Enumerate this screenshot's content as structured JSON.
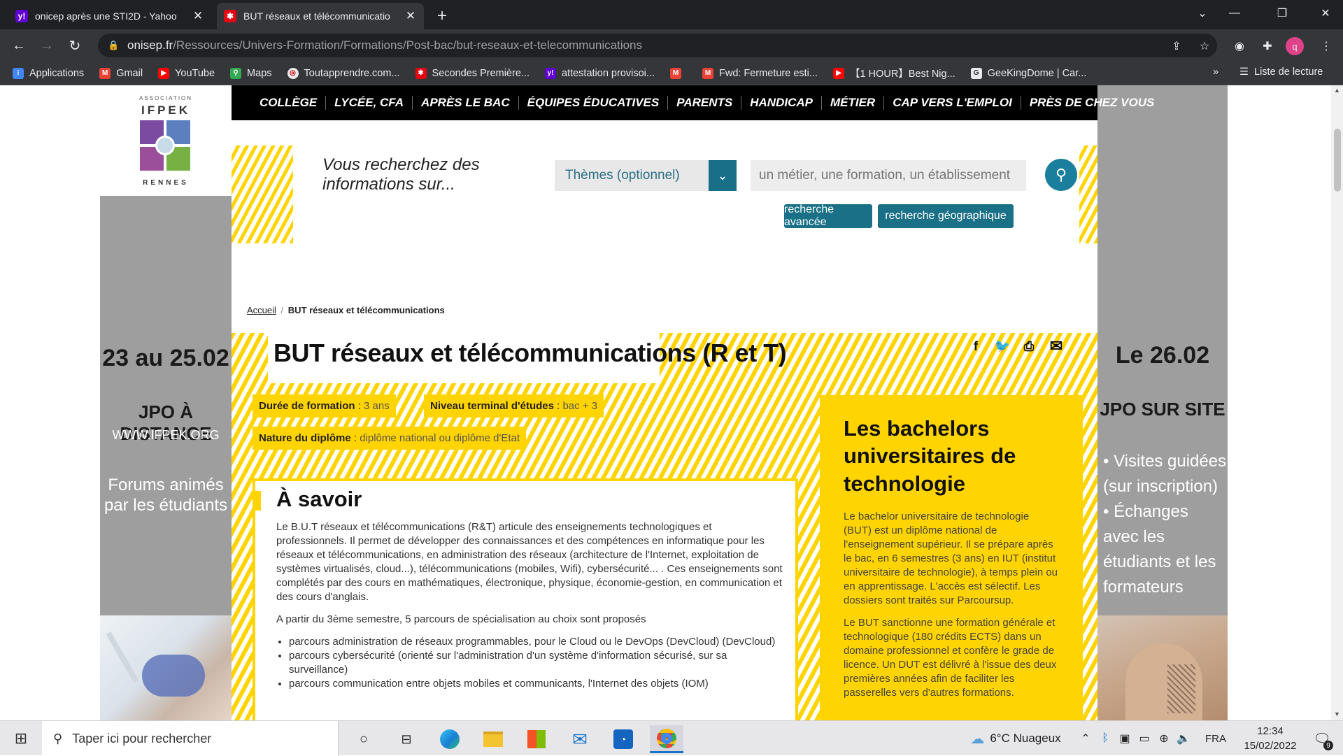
{
  "browser": {
    "tabs": [
      {
        "title": "onicep après une STI2D - Yahoo",
        "favicon": "yahoo-icon",
        "active": false
      },
      {
        "title": "BUT réseaux et télécommunicatio",
        "favicon": "onisep-icon",
        "active": true
      }
    ],
    "new_tab": "+",
    "url_host": "onisep.fr",
    "url_path": "/Ressources/Univers-Formation/Formations/Post-bac/but-reseaux-et-telecommunications",
    "bookmarks": [
      {
        "label": "Applications",
        "icon": "apps-grid-icon",
        "color": "#4285f4"
      },
      {
        "label": "Gmail",
        "icon": "gmail-icon",
        "color": "#ea4335"
      },
      {
        "label": "YouTube",
        "icon": "youtube-icon",
        "color": "#ff0000"
      },
      {
        "label": "Maps",
        "icon": "maps-icon",
        "color": "#34a853"
      },
      {
        "label": "Toutapprendre.com...",
        "icon": "toutapprendre-icon",
        "color": "#e8eaed"
      },
      {
        "label": "Secondes Première...",
        "icon": "onisep-icon",
        "color": "#e30613"
      },
      {
        "label": "attestation provisoi...",
        "icon": "yahoo-icon",
        "color": "#6001d2"
      },
      {
        "label": "",
        "icon": "gmail-icon",
        "color": "#ea4335"
      },
      {
        "label": "Fwd: Fermeture esti...",
        "icon": "gmail-icon",
        "color": "#ea4335"
      },
      {
        "label": "【1 HOUR】Best Nig...",
        "icon": "youtube-icon",
        "color": "#ff0000"
      },
      {
        "label": "GeeKingDome | Car...",
        "icon": "geekingdome-icon",
        "color": "#e8eaed"
      }
    ],
    "bookmarks_more": "»",
    "reading_list": "Liste de lecture",
    "profile_initial": "q"
  },
  "ads": {
    "left": {
      "logo_top": "ASSOCIATION",
      "logo_name": "IFPEK",
      "logo_city": "RENNES",
      "dates": "23 au 25.02",
      "event": "JPO À DISTANCE",
      "site": "WWW.IFPEK.ORG",
      "desc": "Forums animés par les étudiants"
    },
    "right": {
      "dates": "Le 26.02",
      "event": "JPO SUR SITE",
      "bullet1": "Visites guidées (sur inscription)",
      "bullet2": "Échanges avec les étudiants et les formateurs"
    }
  },
  "nav": [
    "COLLÈGE",
    "LYCÉE, CFA",
    "APRÈS LE BAC",
    "ÉQUIPES ÉDUCATIVES",
    "PARENTS",
    "HANDICAP",
    "MÉTIER",
    "CAP VERS L'EMPLOI",
    "PRÈS DE CHEZ VOUS"
  ],
  "search": {
    "label": "Vous recherchez des informations sur...",
    "theme_select": "Thèmes (optionnel)",
    "placeholder": "un métier, une formation, un établissement",
    "advanced": "recherche avancée",
    "geo": "recherche géographique"
  },
  "breadcrumb": {
    "home": "Accueil",
    "sep": "/",
    "current": "BUT réseaux et télécommunications"
  },
  "page": {
    "title": "BUT réseaux et télécommunications (R et T)",
    "facts": [
      {
        "label": "Durée de formation",
        "value": "3 ans"
      },
      {
        "label": "Niveau terminal d'études",
        "value": "bac + 3"
      },
      {
        "label": "Nature du diplôme",
        "value": "diplôme national ou diplôme d'Etat"
      }
    ],
    "savoir_title": "À savoir",
    "savoir_p1": "Le B.U.T réseaux et télécommunications (R&T) articule des enseignements technologiques et professionnels. Il permet de développer des connaissances et des compétences en informatique pour les réseaux et télécommunications, en administration des réseaux (architecture de l'Internet, exploitation de systèmes virtualisés, cloud...), télécommunications (mobiles, Wifi), cybersécurité... . Ces enseignements sont complétés par des cours en mathématiques, électronique, physique, économie-gestion, en communication et des cours d'anglais.",
    "savoir_p2": "A partir du 3ème semestre, 5 parcours de spécialisation au choix sont proposés",
    "savoir_list": [
      "parcours administration de réseaux programmables, pour le Cloud ou le DevOps (DevCloud) (DevCloud)",
      "parcours cybersécurité (orienté sur l'administration d'un système d'information sécurisé, sur sa surveillance)",
      "parcours communication entre objets mobiles et communicants, l'Internet des objets (IOM)"
    ],
    "aside_title": "Les bachelors universitaires de technologie",
    "aside_p1": "Le bachelor universitaire de technologie (BUT) est un diplôme national de l'enseignement supérieur. Il se prépare après le bac, en 6 semestres (3 ans) en IUT (institut universitaire de technologie), à temps plein ou en apprentissage. L'accès est sélectif. Les dossiers sont traités sur Parcoursup.",
    "aside_p2": "Le BUT sanctionne une formation générale et technologique (180 crédits ECTS) dans un domaine professionnel et confère le grade de licence.  Un DUT est délivré à l'issue des deux premières années afin de faciliter les passerelles vers d'autres formations."
  },
  "taskbar": {
    "search_placeholder": "Taper ici pour rechercher",
    "weather": "6°C  Nuageux",
    "lang": "FRA",
    "time": "12:34",
    "date": "15/02/2022",
    "notif_count": "9"
  },
  "colors": {
    "accent_yellow": "#ffd400",
    "brand_teal": "#1a7087",
    "nav_black": "#000000"
  }
}
